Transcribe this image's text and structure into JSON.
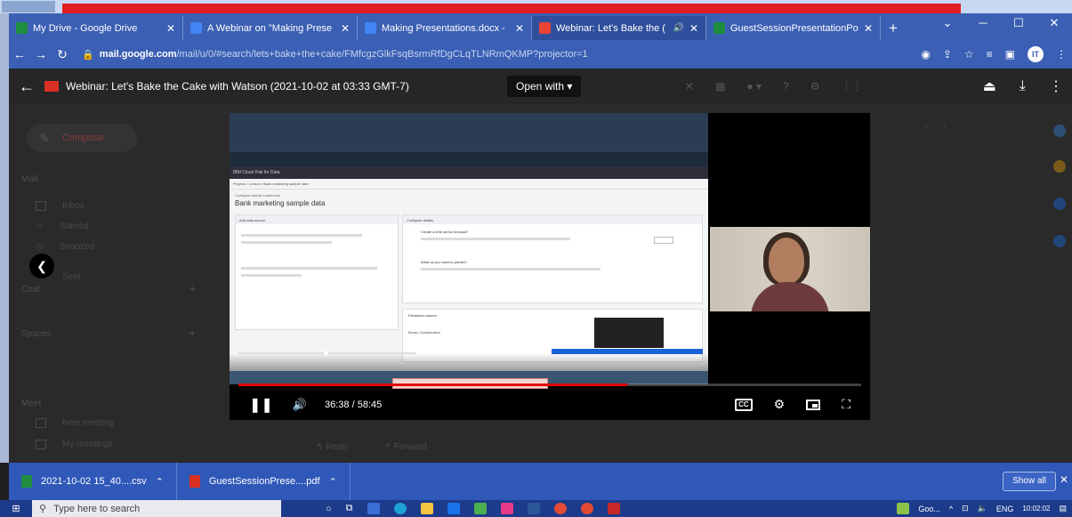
{
  "browser": {
    "tabs": [
      {
        "title": "My Drive - Google Drive",
        "color": "#1e8e3e",
        "active": false
      },
      {
        "title": "A Webinar on \"Making Prese",
        "color": "#4285f4",
        "active": false
      },
      {
        "title": "Making Presentations.docx -",
        "color": "#4285f4",
        "active": false
      },
      {
        "title": "Webinar: Let's Bake the (",
        "color": "#ea4335",
        "active": true,
        "audio": true
      },
      {
        "title": "GuestSessionPresentationPo",
        "color": "#1e8e3e",
        "active": false
      }
    ],
    "new_tab": "+",
    "url_host": "mail.google.com",
    "url_path": "/mail/u/0/#search/lets+bake+the+cake/FMfcgzGlkFsqBsrmRfDgCLqTLNRmQKMP?projector=1"
  },
  "viewer": {
    "title": "Webinar: Let's Bake the Cake with Watson (2021-10-02 at 03:33 GMT-7)",
    "open_with": "Open with"
  },
  "gmail": {
    "compose": "Compose",
    "mail_label": "Mail",
    "items": [
      "Inbox",
      "Starred",
      "Snoozed",
      "Sent"
    ],
    "chat_label": "Chat",
    "spaces_label": "Spaces",
    "meet_label": "Meet",
    "meet_items": [
      "New meeting",
      "My meetings"
    ],
    "reply": "Reply",
    "forward": "Forward"
  },
  "slide": {
    "app_name": "IBM Cloud Pak for Data",
    "breadcrumb": "Projects / Lesson / Bank marketing sample data",
    "subtitle": "Configure AutoAI experiment",
    "heading": "Bank marketing sample data",
    "left_panel_title": "Add data source",
    "right_panel_title": "Configure details",
    "question1": "Create a time series forecast?",
    "question2": "What do you want to predict?",
    "bottom_panel_title": "Prediction column",
    "prediction_type": "Binary Classification"
  },
  "player": {
    "time_current": "36:38",
    "time_total": "58:45",
    "progress_fraction": 0.624
  },
  "downloads": {
    "items": [
      "2021-10-02 15_40....csv",
      "GuestSessionPrese....pdf"
    ],
    "show_all": "Show all"
  },
  "taskbar": {
    "search_placeholder": "Type here to search",
    "tray_app": "Goo...",
    "lang": "ENG",
    "time": "10:02:02"
  }
}
